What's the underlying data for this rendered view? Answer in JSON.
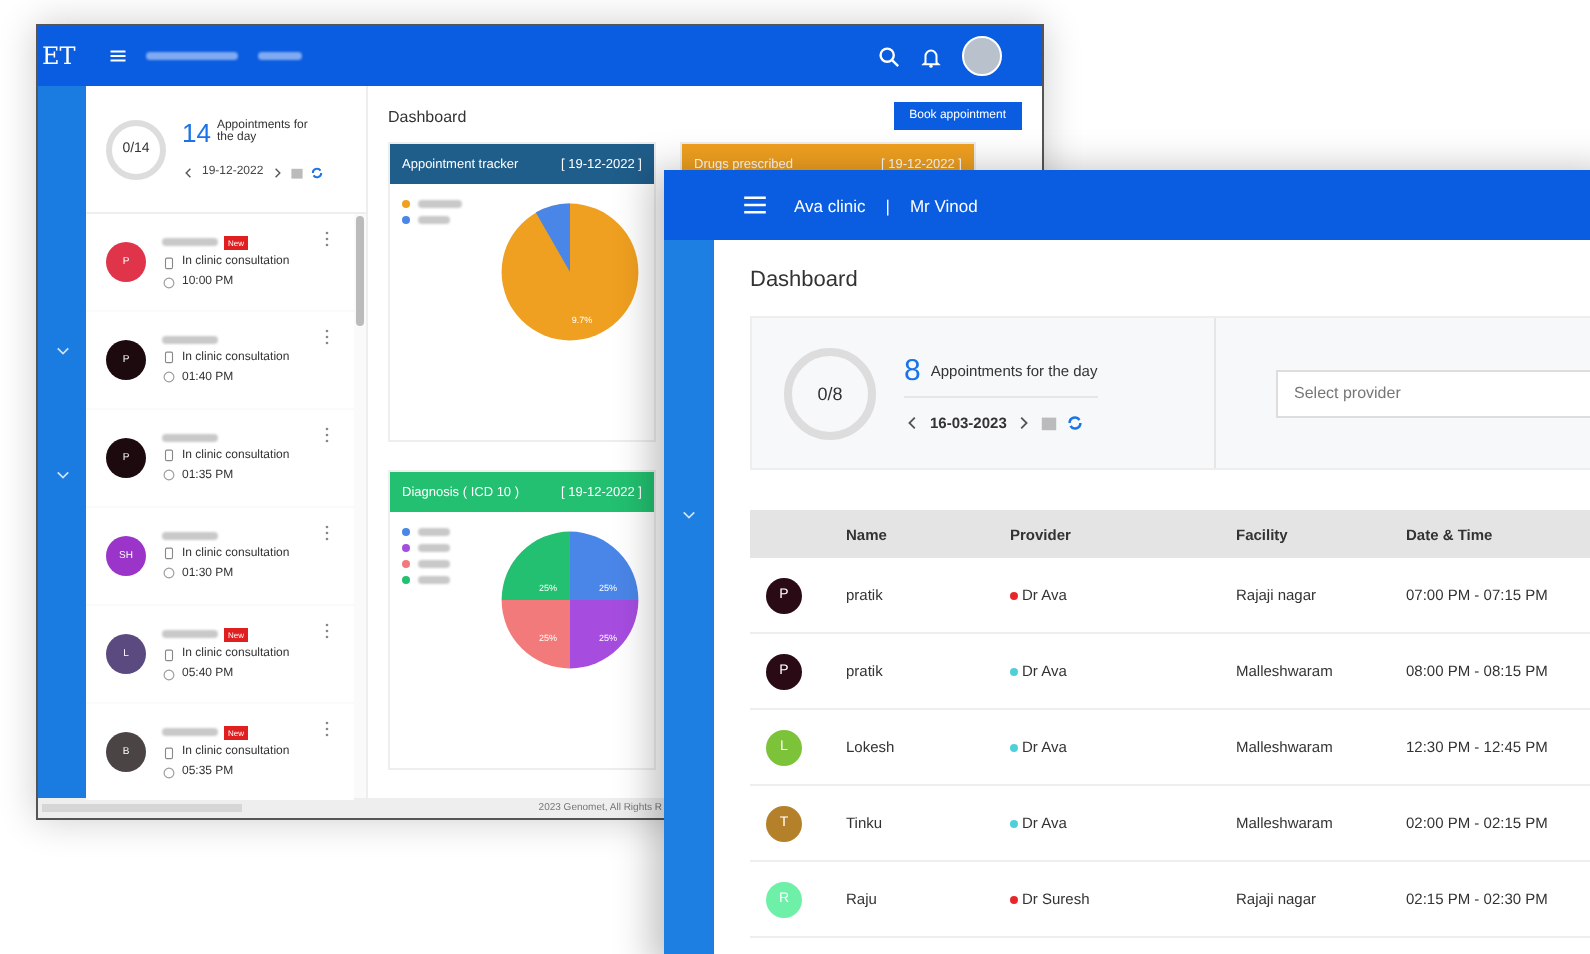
{
  "back_window": {
    "logo": "ET",
    "summary": {
      "progress": "0/14",
      "count": "14",
      "label": "Appointments for the day",
      "date": "19-12-2022"
    },
    "appointments": [
      {
        "initials": "P",
        "color": "#e0344a",
        "badge": "New",
        "type": "In clinic consultation",
        "time": "10:00 PM"
      },
      {
        "initials": "P",
        "color": "#1c0a0e",
        "type": "In clinic consultation",
        "time": "01:40 PM"
      },
      {
        "initials": "P",
        "color": "#1c0a0e",
        "type": "In clinic consultation",
        "time": "01:35 PM"
      },
      {
        "initials": "SH",
        "color": "#9b35c9",
        "type": "In clinic consultation",
        "time": "01:30 PM"
      },
      {
        "initials": "L",
        "color": "#5a4a80",
        "badge": "New",
        "type": "In clinic consultation",
        "time": "05:40 PM"
      },
      {
        "initials": "B",
        "color": "#4a4444",
        "badge": "New",
        "type": "In clinic consultation",
        "time": "05:35 PM"
      }
    ],
    "title": "Dashboard",
    "book_button": "Book appointment",
    "cards": [
      {
        "kind": "tracker",
        "title": "Appointment tracker",
        "date": "[ 19-12-2022 ]",
        "color": "#1f5d8a",
        "slice_labels": [
          "9.7%"
        ]
      },
      {
        "kind": "drugs",
        "title": "Drugs prescribed",
        "date": "[ 19-12-2022 ]",
        "color": "#f0a020"
      },
      {
        "kind": "diagnosis",
        "title": "Diagnosis ( ICD 10 )",
        "date": "[ 19-12-2022 ]",
        "color": "#22c070",
        "slice_labels": [
          "25%",
          "25%",
          "25%",
          "25%"
        ]
      }
    ],
    "footer": "2023 Genomet, All Rights R"
  },
  "front_window": {
    "clinic": "Ava clinic",
    "separator": "|",
    "user": "Mr Vinod",
    "title": "Dashboard",
    "summary": {
      "progress": "0/8",
      "count": "8",
      "label": "Appointments for the day",
      "date": "16-03-2023"
    },
    "provider_select": {
      "placeholder": "Select provider"
    },
    "table": {
      "columns": [
        "Name",
        "Provider",
        "Facility",
        "Date & Time"
      ],
      "rows": [
        {
          "initials": "P",
          "color": "#2a0a14",
          "name": "pratik",
          "provider": {
            "name": "Dr Ava",
            "color": "#e8262a"
          },
          "facility": "Rajaji nagar",
          "time": "07:00 PM - 07:15 PM"
        },
        {
          "initials": "P",
          "color": "#2a0a14",
          "name": "pratik",
          "provider": {
            "name": "Dr Ava",
            "color": "#4fd0d8"
          },
          "facility": "Malleshwaram",
          "time": "08:00 PM - 08:15 PM"
        },
        {
          "initials": "L",
          "color": "#7cc33a",
          "name": "Lokesh",
          "provider": {
            "name": "Dr Ava",
            "color": "#4fd0d8"
          },
          "facility": "Malleshwaram",
          "time": "12:30 PM - 12:45 PM"
        },
        {
          "initials": "T",
          "color": "#b5802a",
          "name": "Tinku",
          "provider": {
            "name": "Dr Ava",
            "color": "#4fd0d8"
          },
          "facility": "Malleshwaram",
          "time": "02:00 PM - 02:15 PM"
        },
        {
          "initials": "R",
          "color": "#6ff0a8",
          "name": "Raju",
          "provider": {
            "name": "Dr Suresh",
            "color": "#e8262a"
          },
          "facility": "Rajaji nagar",
          "time": "02:15 PM - 02:30 PM"
        }
      ]
    }
  }
}
